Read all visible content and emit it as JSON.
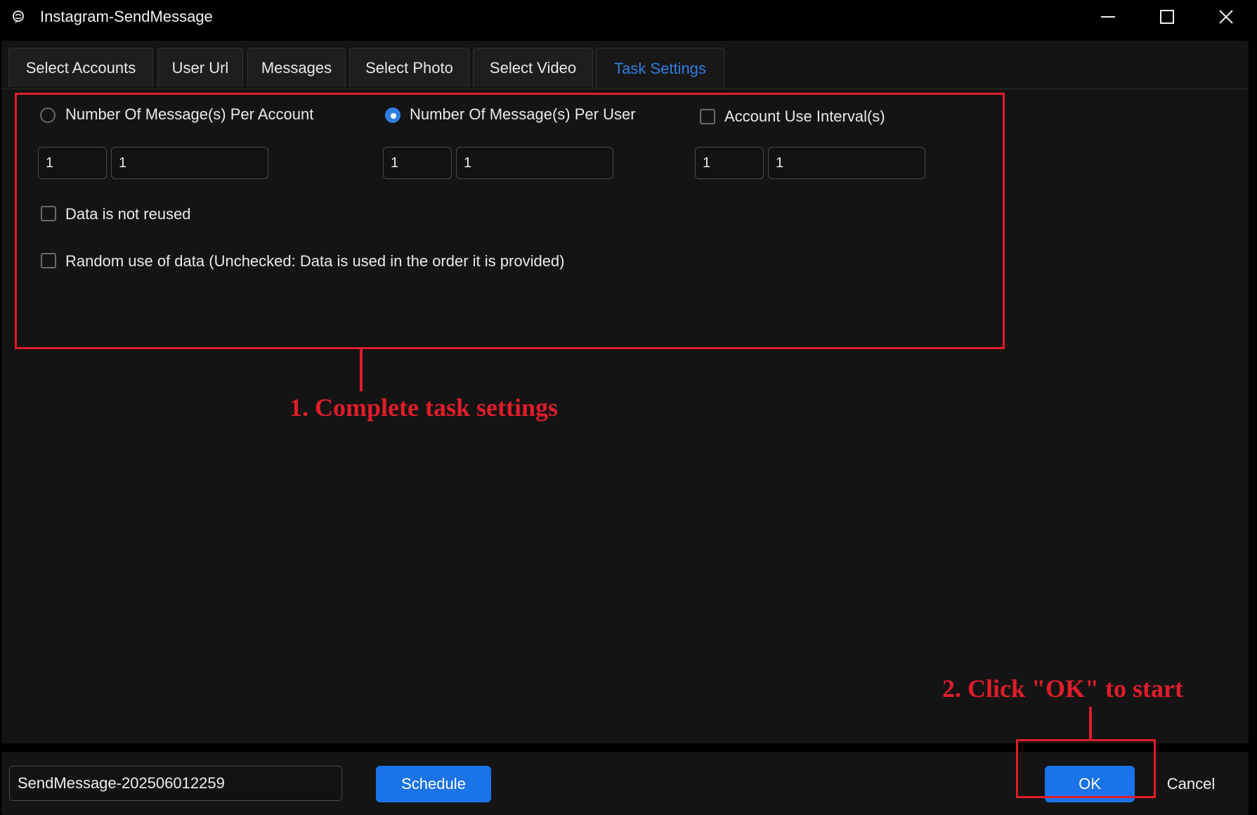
{
  "window": {
    "title": "Instagram-SendMessage",
    "icon": "app-icon",
    "controls": [
      "minimize-icon",
      "maximize-icon",
      "close-icon"
    ]
  },
  "tabs": [
    {
      "label": "Select Accounts",
      "active": false
    },
    {
      "label": "User Url",
      "active": false
    },
    {
      "label": "Messages",
      "active": false
    },
    {
      "label": "Select Photo",
      "active": false
    },
    {
      "label": "Select Video",
      "active": false
    },
    {
      "label": "Task Settings",
      "active": true
    }
  ],
  "settings": {
    "per_account": {
      "label": "Number Of Message(s) Per Account",
      "selected": false,
      "min": "1",
      "max": "1"
    },
    "per_user": {
      "label": "Number Of Message(s) Per User",
      "selected": true,
      "min": "1",
      "max": "1"
    },
    "interval": {
      "label": "Account Use Interval(s)",
      "checked": false,
      "min": "1",
      "max": "1"
    },
    "not_reused": {
      "label": "Data is not reused",
      "checked": false
    },
    "random_use": {
      "label": "Random use of data (Unchecked: Data is used in the order it is provided)",
      "checked": false
    }
  },
  "annotations": {
    "step1": "1. Complete task settings",
    "step2": "2. Click \"OK\" to start"
  },
  "bottom": {
    "task_name": "SendMessage-202506012259",
    "schedule_label": "Schedule",
    "ok_label": "OK",
    "cancel_label": "Cancel"
  },
  "colors": {
    "accent": "#1a73e8",
    "active_tab_text": "#2f7fe0",
    "annotation_red": "#e01d2a",
    "background": "#141414"
  }
}
